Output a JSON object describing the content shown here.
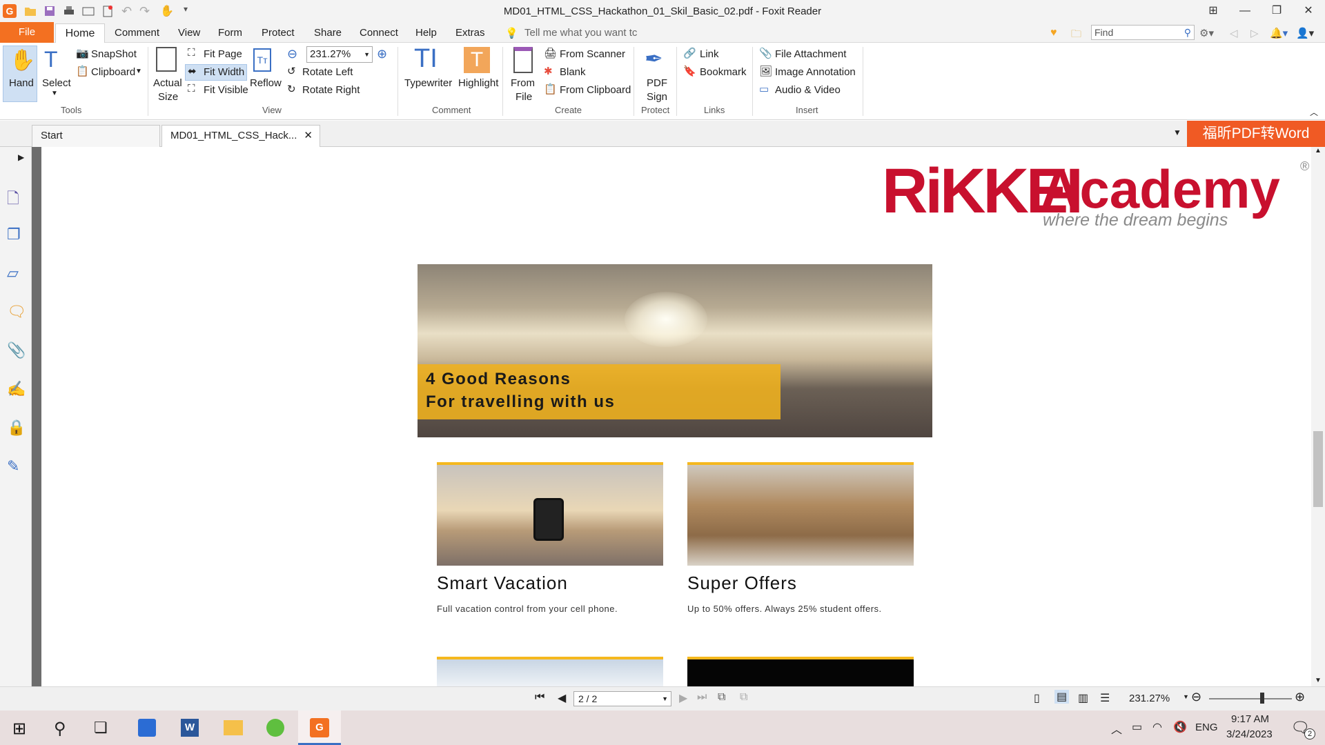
{
  "window": {
    "title": "MD01_HTML_CSS_Hackathon_01_Skil_Basic_02.pdf - Foxit Reader"
  },
  "menu": {
    "file": "File",
    "home": "Home",
    "items": [
      "Comment",
      "View",
      "Form",
      "Protect",
      "Share",
      "Connect",
      "Help",
      "Extras"
    ],
    "tell_me": "Tell me what you want tc",
    "find_placeholder": "Find"
  },
  "ribbon": {
    "tools": {
      "hand": "Hand",
      "select": "Select",
      "snapshot": "SnapShot",
      "clipboard": "Clipboard",
      "group": "Tools"
    },
    "view": {
      "actual_size_1": "Actual",
      "actual_size_2": "Size",
      "fit_page": "Fit Page",
      "fit_width": "Fit Width",
      "fit_visible": "Fit Visible",
      "reflow": "Reflow",
      "zoom": "231.27%",
      "rotate_left": "Rotate Left",
      "rotate_right": "Rotate Right",
      "group": "View"
    },
    "comment": {
      "typewriter": "Typewriter",
      "highlight": "Highlight",
      "group": "Comment"
    },
    "create": {
      "from_file_1": "From",
      "from_file_2": "File",
      "from_scanner": "From Scanner",
      "blank": "Blank",
      "from_clipboard": "From Clipboard",
      "group": "Create"
    },
    "protect": {
      "pdf_sign_1": "PDF",
      "pdf_sign_2": "Sign",
      "group": "Protect"
    },
    "links": {
      "link": "Link",
      "bookmark": "Bookmark",
      "group": "Links"
    },
    "insert": {
      "file_attachment": "File Attachment",
      "image_annotation": "Image Annotation",
      "audio_video": "Audio & Video",
      "group": "Insert"
    }
  },
  "tabs": {
    "start": "Start",
    "doc": "MD01_HTML_CSS_Hack...",
    "promo": "福昕PDF转Word"
  },
  "document": {
    "logo_rk": "RiKKEI",
    "logo_academy": "Academy",
    "logo_tagline": "where the dream begins",
    "logo_reg": "®",
    "hero_line1": "4 Good Reasons",
    "hero_line2": "For travelling with us",
    "cards": [
      {
        "title": "Smart Vacation",
        "desc": "Full vacation control from your cell phone."
      },
      {
        "title": "Super Offers",
        "desc": "Up to 50% offers. Always 25% student offers."
      }
    ]
  },
  "status": {
    "page": "2 / 2",
    "zoom": "231.27%"
  },
  "taskbar": {
    "lang": "ENG",
    "time": "9:17 AM",
    "date": "3/24/2023",
    "notif_count": "2"
  },
  "colors": {
    "accent": "#f37021",
    "gold": "#f5b81e",
    "logo_red": "#c8102e",
    "logo_grey": "#8a8a8a"
  }
}
